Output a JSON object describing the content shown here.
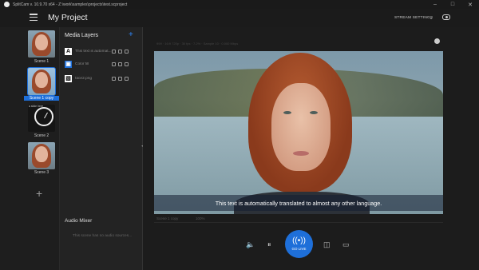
{
  "titlebar": {
    "title": "SplitCam v. 10.9.70 x64 - Z:\\work\\samples\\projects\\test.scproject",
    "minimize": "–",
    "maximize": "□",
    "close": "✕"
  },
  "header": {
    "project_title": "My Project",
    "stream_settings": "STREAM SETTINGS",
    "stream_chevron": "⌄"
  },
  "scenes": [
    {
      "label": "Scene 1"
    },
    {
      "label": "Scene 1 copy"
    },
    {
      "label": "Scene 2"
    },
    {
      "label": "Scene 3"
    }
  ],
  "scene2_overlay_text": "a slide here",
  "add_scene": "+",
  "media_layers": {
    "title": "Media Layers",
    "add": "+",
    "items": [
      {
        "icon": "A",
        "name": "This text is automat..."
      },
      {
        "icon": "▣",
        "name": "Color fill"
      },
      {
        "icon": "▧",
        "name": "face2.png"
      }
    ]
  },
  "audio_mixer": {
    "title": "Audio Mixer",
    "empty_text": "This scene has no audio sources..."
  },
  "preview": {
    "header_text": "999 · 16:9 720p · 30 fps · 7.2% · Sample 10 · 0.000 Mbps",
    "caption": "This text is automatically translated to almost any other language.",
    "status_scene": "Scene 1 copy",
    "status_zoom": "100%"
  },
  "controls": {
    "mute_icon": "🔈",
    "pause_icon": "⏸",
    "golive_icon": "((•))",
    "golive_label": "GO LIVE",
    "snapshot_icon": "◫",
    "record_icon": "▭"
  },
  "colors": {
    "accent": "#1e6fd9",
    "background": "#1e1e1e"
  }
}
